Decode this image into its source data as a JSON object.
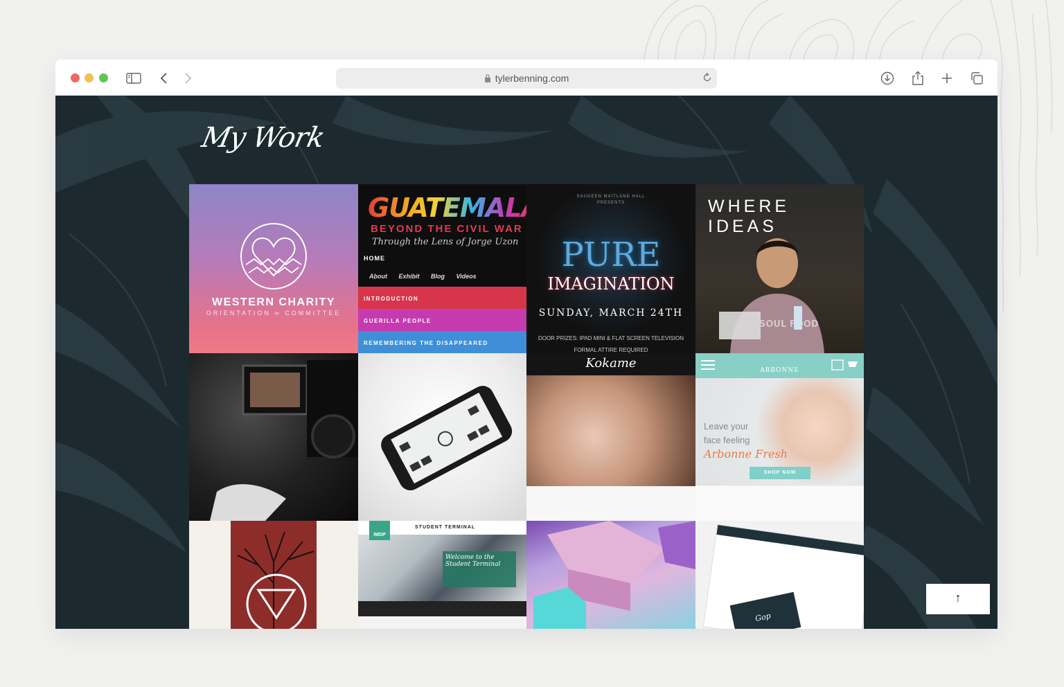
{
  "browser": {
    "url": "tylerbenning.com",
    "colors": {
      "close": "#ed6a5e",
      "minimize": "#f5bf4f",
      "maximize": "#61c554"
    }
  },
  "page": {
    "heading": "My Work",
    "scroll_top_label": "↑"
  },
  "tiles": {
    "western_charity": {
      "title": "WESTERN CHARITY",
      "subtitle": "ORIENTATION ∞ COMMITTEE"
    },
    "guatemala": {
      "title": "GUATEMALA",
      "subtitle": "BEYOND THE CIVIL WAR",
      "byline": "Through the Lens of Jorge Uzon",
      "nav_home": "HOME",
      "nav_links": "About Exhibit  Blog  Videos",
      "sections": [
        "INTRODUCTION",
        "GUERILLA PEOPLE",
        "REMEMBERING THE DISAPPEARED"
      ]
    },
    "pure_imagination": {
      "presenter": "SAUGEEN MAITLAND HALL",
      "presents": "PRESENTS",
      "title": "PURE",
      "title2": "IMAGINATION",
      "date": "SUNDAY, MARCH 24TH",
      "prizes": "DOOR PRIZES: IPAD MINI & FLAT SCREEN TELEVISION",
      "attire": "FORMAL ATTIRE REQUIRED"
    },
    "where_ideas": {
      "title": "WHERE IDEAS",
      "shirt": "SOUL FOOD"
    },
    "kokame": {
      "brand": "Kokame"
    },
    "arbonne": {
      "brand": "ARBONNE",
      "line1": "Leave your",
      "line2": "face feeling",
      "product": "Arbonne Fresh",
      "cta": "SHOP NOW"
    },
    "terminal": {
      "badge": "IMDP",
      "nav": "STUDENT TERMINAL",
      "welcome_1": "Welcome to the",
      "welcome_2": "Student Terminal"
    },
    "gop": {
      "logo": "Gop"
    }
  }
}
